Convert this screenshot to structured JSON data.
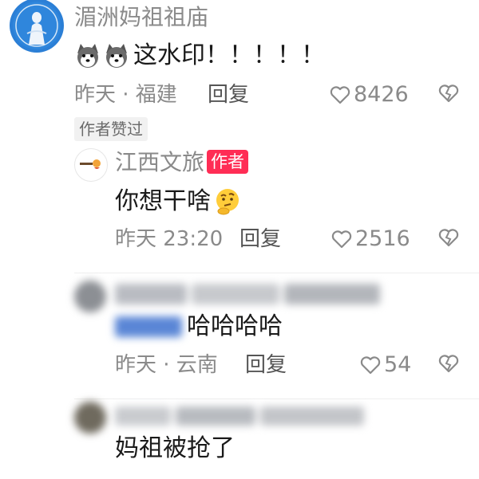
{
  "comment1": {
    "user": "湄洲妈祖祖庙",
    "avatar_icon": "goddess-statue-icon",
    "text": "这水印！！！！！",
    "text_emoji": "husky-dog-emoji",
    "time_location": "昨天 · 福建",
    "reply_label": "回复",
    "likes": "8426",
    "badge": "作者赞过"
  },
  "reply1": {
    "user": "江西文旅",
    "author_tag": "作者",
    "text": "你想干啥",
    "text_emoji": "thinking-face-emoji",
    "time": "昨天 23:20",
    "reply_label": "回复",
    "likes": "2516"
  },
  "reply2": {
    "text": "哈哈哈哈",
    "time_location": "昨天 · 云南",
    "reply_label": "回复",
    "likes": "54"
  },
  "reply3": {
    "text": "妈祖被抢了"
  },
  "colors": {
    "meta_gray": "#8a8a8a",
    "author_tag_bg": "#ff2d55",
    "avatar_blue": "#2b7fd6"
  }
}
